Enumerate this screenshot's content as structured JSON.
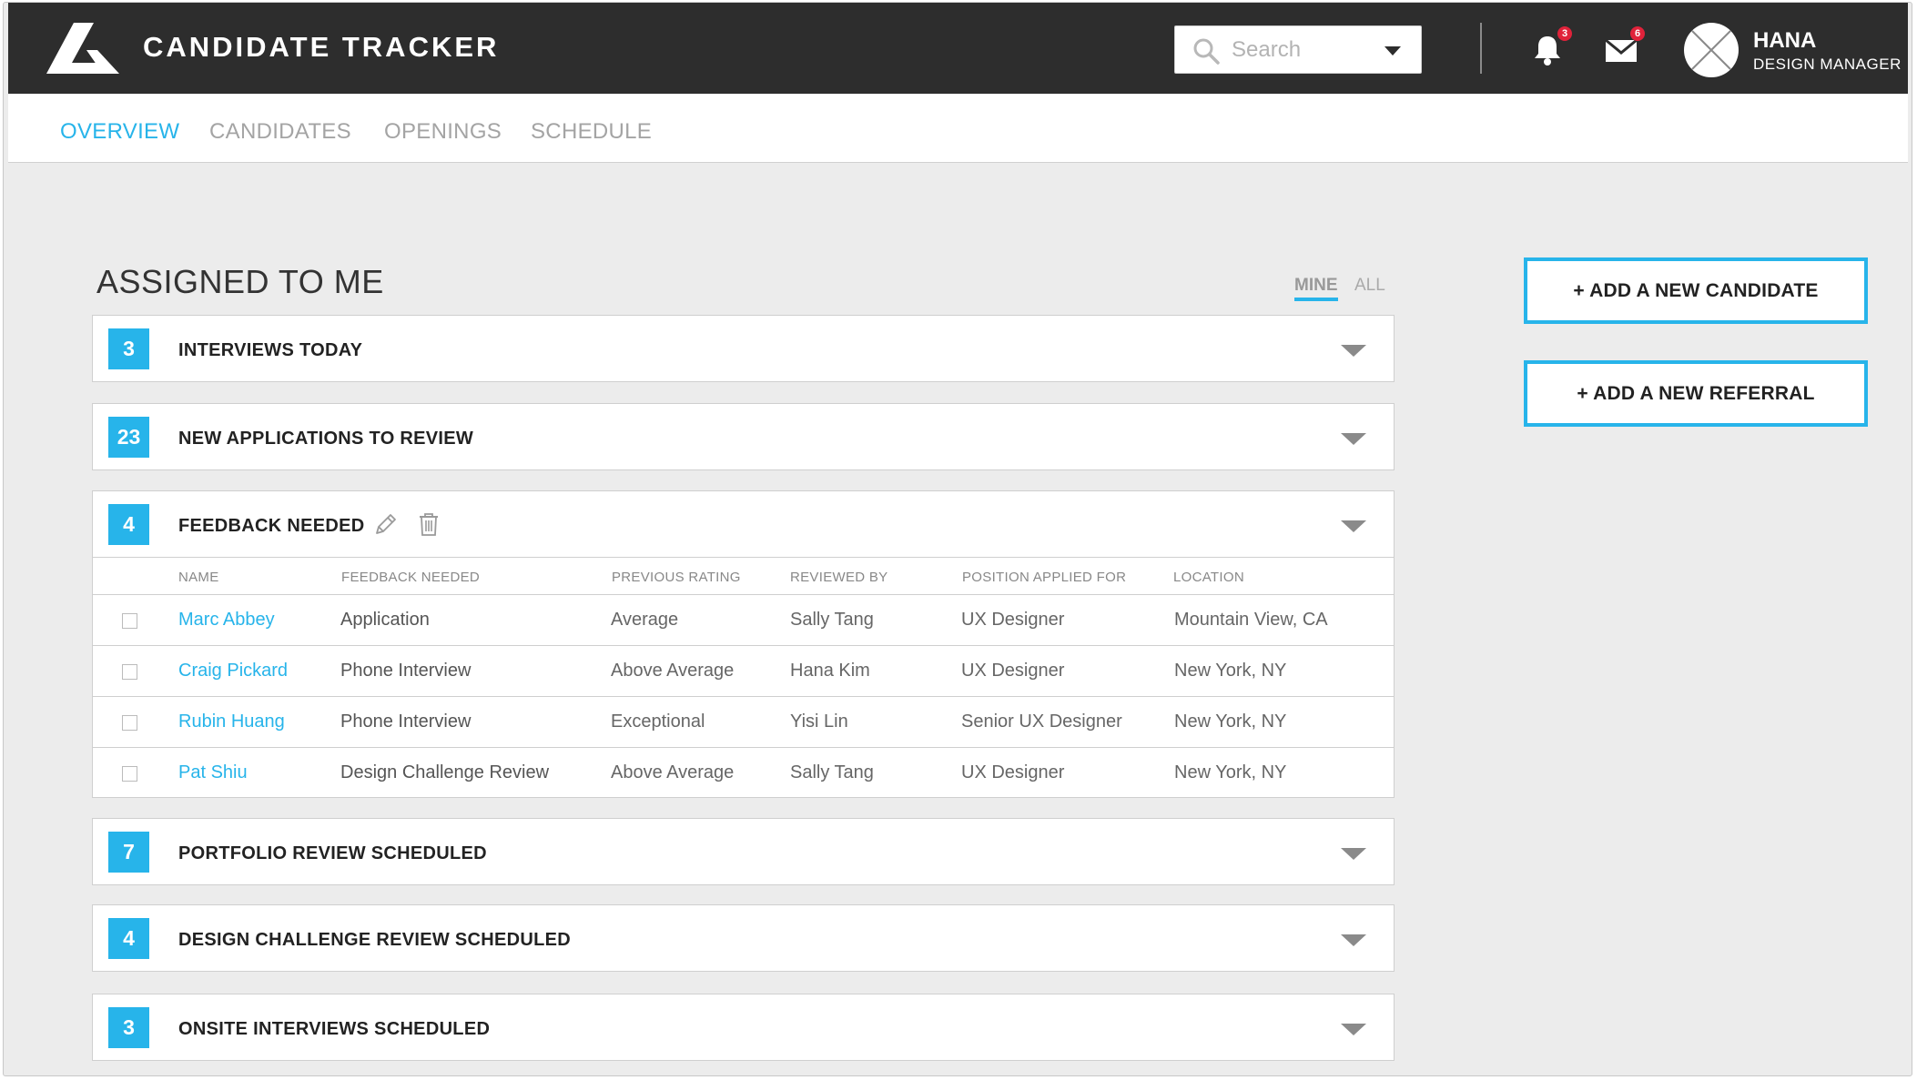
{
  "app": {
    "title": "CANDIDATE TRACKER"
  },
  "search": {
    "placeholder": "Search",
    "value": ""
  },
  "notifications": {
    "count": "3"
  },
  "messages": {
    "count": "6"
  },
  "user": {
    "name": "HANA",
    "role": "DESIGN MANAGER"
  },
  "nav": {
    "tabs": [
      {
        "label": "OVERVIEW",
        "active": true
      },
      {
        "label": "CANDIDATES",
        "active": false
      },
      {
        "label": "OPENINGS",
        "active": false
      },
      {
        "label": "SCHEDULE",
        "active": false
      }
    ]
  },
  "section": {
    "title": "ASSIGNED TO ME",
    "filters": [
      "MINE",
      "ALL"
    ],
    "selected_filter": "MINE"
  },
  "panels": [
    {
      "count": "3",
      "label": "INTERVIEWS TODAY"
    },
    {
      "count": "23",
      "label": "NEW APPLICATIONS TO REVIEW"
    },
    {
      "count": "4",
      "label": "FEEDBACK NEEDED",
      "expanded": true
    },
    {
      "count": "7",
      "label": "PORTFOLIO REVIEW SCHEDULED"
    },
    {
      "count": "4",
      "label": "DESIGN CHALLENGE REVIEW SCHEDULED"
    },
    {
      "count": "3",
      "label": "ONSITE INTERVIEWS SCHEDULED"
    }
  ],
  "feedback_table": {
    "columns": [
      "NAME",
      "FEEDBACK NEEDED",
      "PREVIOUS RATING",
      "REVIEWED BY",
      "POSITION APPLIED FOR",
      "LOCATION"
    ],
    "rows": [
      {
        "name": "Marc Abbey",
        "feedback": "Application",
        "rating": "Average",
        "reviewer": "Sally Tang",
        "position": "UX Designer",
        "location": "Mountain View, CA"
      },
      {
        "name": "Craig Pickard",
        "feedback": "Phone Interview",
        "rating": "Above Average",
        "reviewer": "Hana Kim",
        "position": "UX Designer",
        "location": "New York, NY"
      },
      {
        "name": "Rubin Huang",
        "feedback": "Phone Interview",
        "rating": "Exceptional",
        "reviewer": "Yisi Lin",
        "position": "Senior UX Designer",
        "location": "New York, NY"
      },
      {
        "name": "Pat Shiu",
        "feedback": "Design Challenge Review",
        "rating": "Above Average",
        "reviewer": "Sally Tang",
        "position": "UX Designer",
        "location": "New York, NY"
      }
    ]
  },
  "actions": {
    "add_candidate": "+ ADD A NEW CANDIDATE",
    "add_referral": "+ ADD A NEW REFERRAL"
  },
  "colors": {
    "accent": "#27b4ea",
    "topbar": "#2d2d2d",
    "badge": "#e0223a",
    "background": "#ececec"
  }
}
